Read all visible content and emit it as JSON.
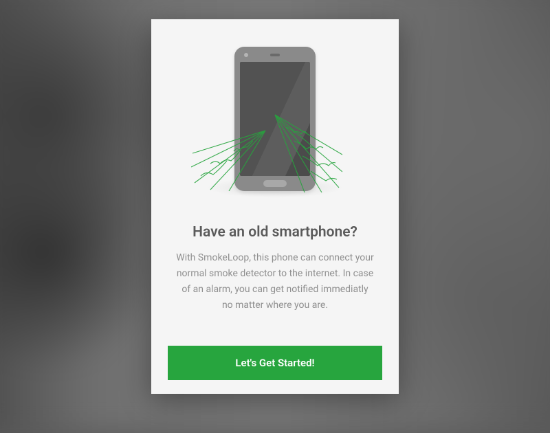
{
  "card": {
    "heading": "Have an old smartphone?",
    "body": "With SmokeLoop, this phone can connect your normal smoke detector to the internet. In case of an alarm, you can get notified immediatly no matter where you are.",
    "cta_label": "Let's Get Started!"
  },
  "colors": {
    "accent": "#27a53e",
    "card_bg": "#f5f5f5",
    "heading": "#5a5a5a",
    "body": "#8f8f8f"
  }
}
